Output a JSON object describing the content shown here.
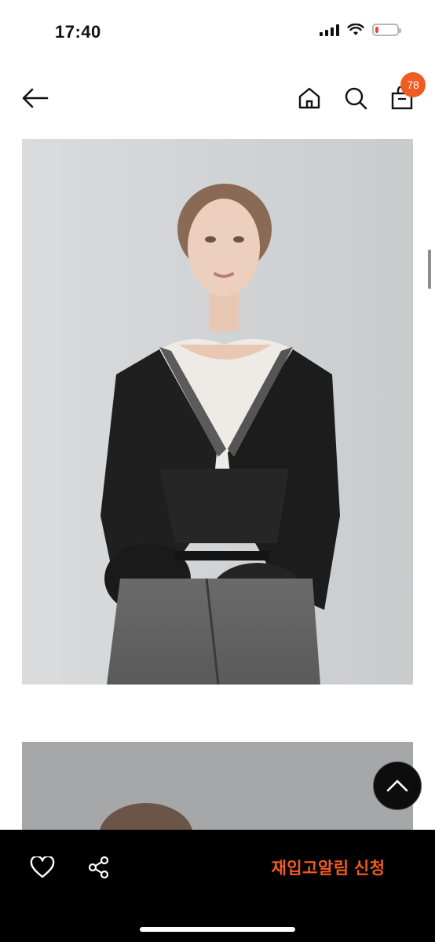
{
  "status_bar": {
    "time": "17:40",
    "icons": [
      "signal-icon",
      "wifi-icon",
      "battery-icon"
    ],
    "battery_level": 0.15,
    "battery_color": "#e5483a"
  },
  "nav": {
    "back_icon": "arrow-left-icon",
    "home_icon": "home-icon",
    "search_icon": "search-icon",
    "bag_icon": "shopping-bag-icon",
    "cart_count": "78",
    "badge_color": "#f05a23"
  },
  "product_images": [
    {
      "subject": "model-photo"
    },
    {
      "subject": "model-photo"
    }
  ],
  "scroll_top": {
    "icon": "chevron-up-icon"
  },
  "bottom_bar": {
    "wish_icon": "heart-icon",
    "share_icon": "share-icon",
    "restock_label": "재입고알림 신청",
    "accent_color": "#f05a23",
    "background": "#000000"
  }
}
